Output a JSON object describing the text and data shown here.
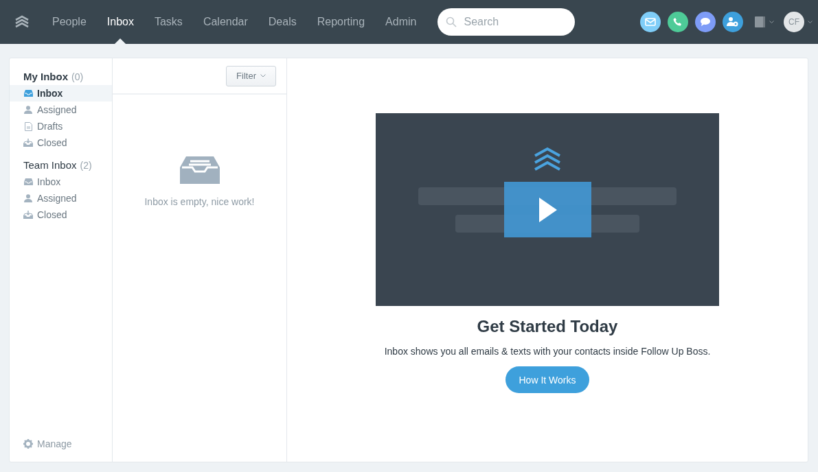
{
  "nav": {
    "items": [
      {
        "label": "People",
        "selected": false
      },
      {
        "label": "Inbox",
        "selected": true
      },
      {
        "label": "Tasks",
        "selected": false
      },
      {
        "label": "Calendar",
        "selected": false
      },
      {
        "label": "Deals",
        "selected": false
      },
      {
        "label": "Reporting",
        "selected": false
      },
      {
        "label": "Admin",
        "selected": false
      }
    ],
    "search": {
      "placeholder": "Search"
    },
    "actions": [
      {
        "kind": "email",
        "color": "#7fcdf8"
      },
      {
        "kind": "phone",
        "color": "#4ecb98"
      },
      {
        "kind": "chat",
        "color": "#7e9cf7"
      },
      {
        "kind": "assign",
        "color": "#3ea0dc"
      }
    ],
    "avatar": "CF"
  },
  "sidebar": {
    "sections": [
      {
        "title": "My Inbox",
        "count": "(0)",
        "items": [
          {
            "kind": "inbox",
            "label": "Inbox",
            "selected": true
          },
          {
            "kind": "person",
            "label": "Assigned",
            "selected": false
          },
          {
            "kind": "draft",
            "label": "Drafts",
            "selected": false
          },
          {
            "kind": "closed",
            "label": "Closed",
            "selected": false
          }
        ]
      },
      {
        "title": "Team Inbox",
        "count": "(2)",
        "items": [
          {
            "kind": "inbox",
            "label": "Inbox",
            "selected": false
          },
          {
            "kind": "person",
            "label": "Assigned",
            "selected": false
          },
          {
            "kind": "closed",
            "label": "Closed",
            "selected": false
          }
        ]
      }
    ],
    "manage": "Manage"
  },
  "list": {
    "filter": "Filter",
    "empty": "Inbox is empty, nice work!"
  },
  "welcome": {
    "heading": "Get Started Today",
    "text": "Inbox shows you all emails & texts with your contacts inside Follow Up Boss.",
    "button": "How It Works"
  }
}
